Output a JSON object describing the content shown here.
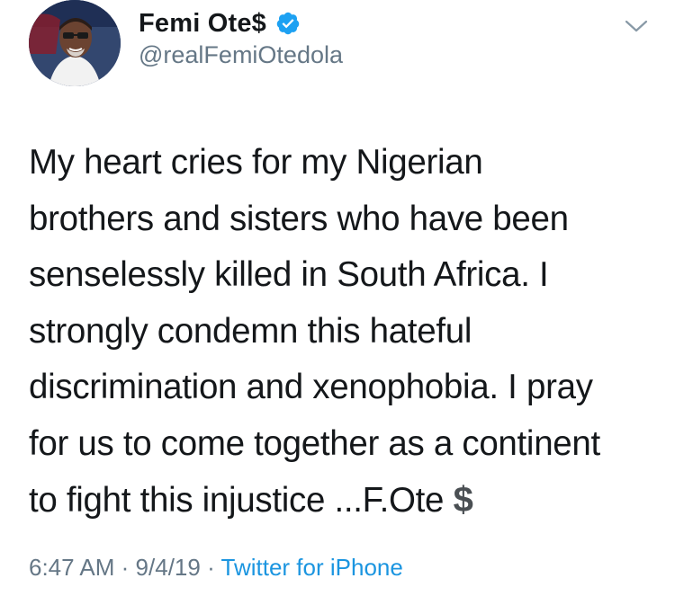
{
  "author": {
    "display_name": "Femi Ote$",
    "handle": "@realFemiOtedola",
    "verified_icon": "verified-badge-icon",
    "avatar_icon": "profile-photo"
  },
  "tweet": {
    "text": "My heart cries for my Nigerian\nbrothers and sisters who have been\nsenselessly killed in South Africa. I\nstrongly condemn this hateful\ndiscrimination and xenophobia. I pray\nfor us to come together as a continent\nto fight this injustice ...F.Ote",
    "trailing_emoji": "$",
    "time": "6:47 AM",
    "separator": "·",
    "date": "9/4/19",
    "source": "Twitter for iPhone"
  },
  "menu": {
    "icon": "chevron-down-icon"
  },
  "colors": {
    "text": "#14171a",
    "secondary": "#657786",
    "link": "#1b95e0",
    "verified": "#1da1f2"
  }
}
